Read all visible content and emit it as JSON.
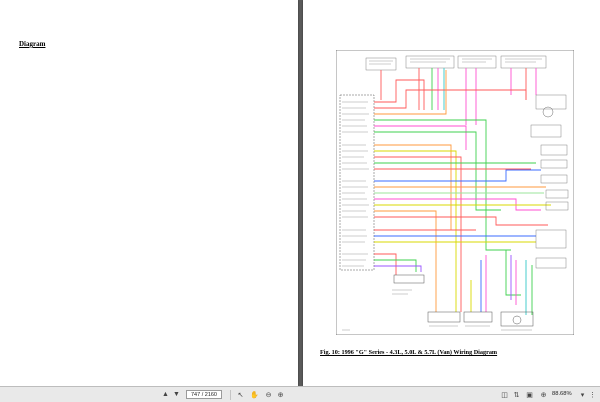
{
  "left_page": {
    "heading": "Diagram"
  },
  "right_page": {
    "caption": "Fig. 10: 1996 \"G\" Series - 4.3L, 5.0L & 5.7L (Van) Wiring Diagram"
  },
  "toolbar": {
    "page_indicator": "747 / 2160",
    "zoom_level": "88.68%",
    "icons": [
      "up-arrow-icon",
      "down-arrow-icon",
      "cursor-icon",
      "hand-icon",
      "zoom-out-icon",
      "zoom-in-icon",
      "fit-page-icon",
      "chevron-down-icon",
      "scroll-icon",
      "fullscreen-icon",
      "more-icon"
    ]
  },
  "colors": {
    "wire_red": "#ff5a5a",
    "wire_pink": "#ff4fd0",
    "wire_green": "#3fd04f",
    "wire_yellow": "#d9d900",
    "wire_orange": "#ff9a3c",
    "wire_blue": "#3b6bff",
    "wire_purple": "#9a55ff",
    "wire_cyan": "#33c9c9",
    "wire_lightgreen": "#9be69b"
  }
}
